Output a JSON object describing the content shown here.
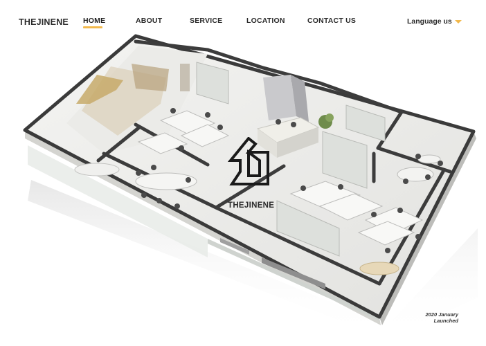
{
  "nav": {
    "brand": "THEJINENE",
    "items": [
      {
        "label": "HOME"
      },
      {
        "label": "ABOUT"
      },
      {
        "label": "SERVICE"
      },
      {
        "label": "LOCATION"
      },
      {
        "label": "CONTACT US"
      }
    ],
    "active": "HOME",
    "language_label": "Language us"
  },
  "hero": {
    "logo_text": "THEJINENE",
    "launch_line1": "2020 January",
    "launch_line2": "Launched"
  },
  "colors": {
    "accent": "#f2b84b",
    "text": "#2b2b2b",
    "wall": "#3c3c3c",
    "floor": "#ececec"
  },
  "icons": [
    "chevron-down-icon",
    "building-logo-icon"
  ]
}
